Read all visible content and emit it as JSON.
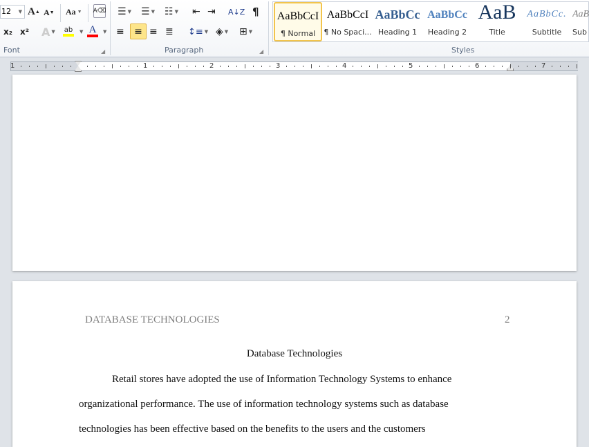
{
  "ribbon": {
    "font": {
      "size": "12",
      "label": "Font",
      "grow": "A",
      "shrink": "A",
      "change_case": "Aa",
      "subscript": "x₂",
      "superscript": "x²",
      "text_effects": "A",
      "highlight": "ab",
      "font_color": "A",
      "highlight_color": "#ffff00",
      "font_color_value": "#ff0000"
    },
    "paragraph": {
      "label": "Paragraph",
      "show_marks": "¶",
      "sort": "A↓Z"
    },
    "styles": {
      "label": "Styles",
      "items": [
        {
          "preview": "AaBbCcI",
          "name": "¶ Normal",
          "color": "#000000"
        },
        {
          "preview": "AaBbCcI",
          "name": "¶ No Spaci...",
          "color": "#000000"
        },
        {
          "preview": "AaBbCc",
          "name": "Heading 1",
          "color": "#365f91"
        },
        {
          "preview": "AaBbCc",
          "name": "Heading 2",
          "color": "#4f81bd"
        },
        {
          "preview": "AaB",
          "name": "Title",
          "color": "#17365d"
        },
        {
          "preview": "AaBbCc.",
          "name": "Subtitle",
          "color": "#4f81bd"
        },
        {
          "preview": "AaBbCc",
          "name": "Sub",
          "color": "#808080"
        }
      ]
    }
  },
  "ruler": {
    "numbers": [
      "1",
      "1",
      "2",
      "3",
      "4",
      "5",
      "6",
      "7"
    ]
  },
  "document": {
    "header_title": "DATABASE TECHNOLOGIES",
    "page_number": "2",
    "title": "Database Technologies",
    "lines": [
      "Retail stores have adopted the use of Information Technology  Systems to enhance",
      "organizational performance. The use of information technology systems such as database",
      "technologies has been effective based on the benefits to the users and the customers"
    ]
  }
}
